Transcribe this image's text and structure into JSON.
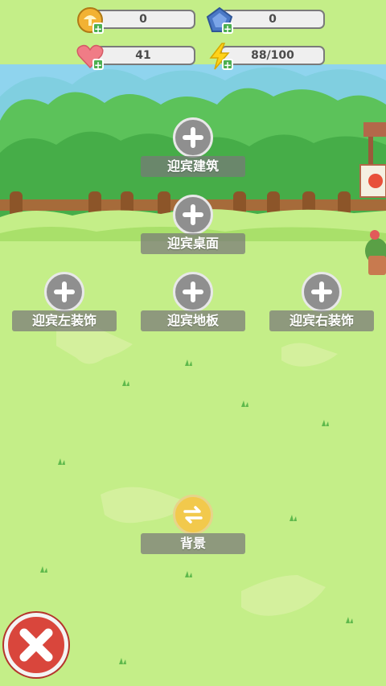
{
  "resources": {
    "coins": "0",
    "gems": "0",
    "hearts": "41",
    "energy": "88/100"
  },
  "slots": {
    "building": "迎宾建筑",
    "table": "迎宾桌面",
    "left_decor": "迎宾左装饰",
    "floor": "迎宾地板",
    "right_decor": "迎宾右装饰",
    "background": "背景"
  },
  "icons": {
    "coins": "mushroom-coin-icon",
    "gems": "pentagon-gem-icon",
    "hearts": "heart-icon",
    "energy": "lightning-icon",
    "slot_add": "plus-icon",
    "background_swap": "swap-arrows-icon",
    "close": "close-icon"
  },
  "colors": {
    "grass": "#c4ee88",
    "sky": "#8fd4ee",
    "coin": "#f2b233",
    "gem": "#4a78c6",
    "heart": "#f07c86",
    "energy": "#ffd21a",
    "close": "#d9463c"
  }
}
